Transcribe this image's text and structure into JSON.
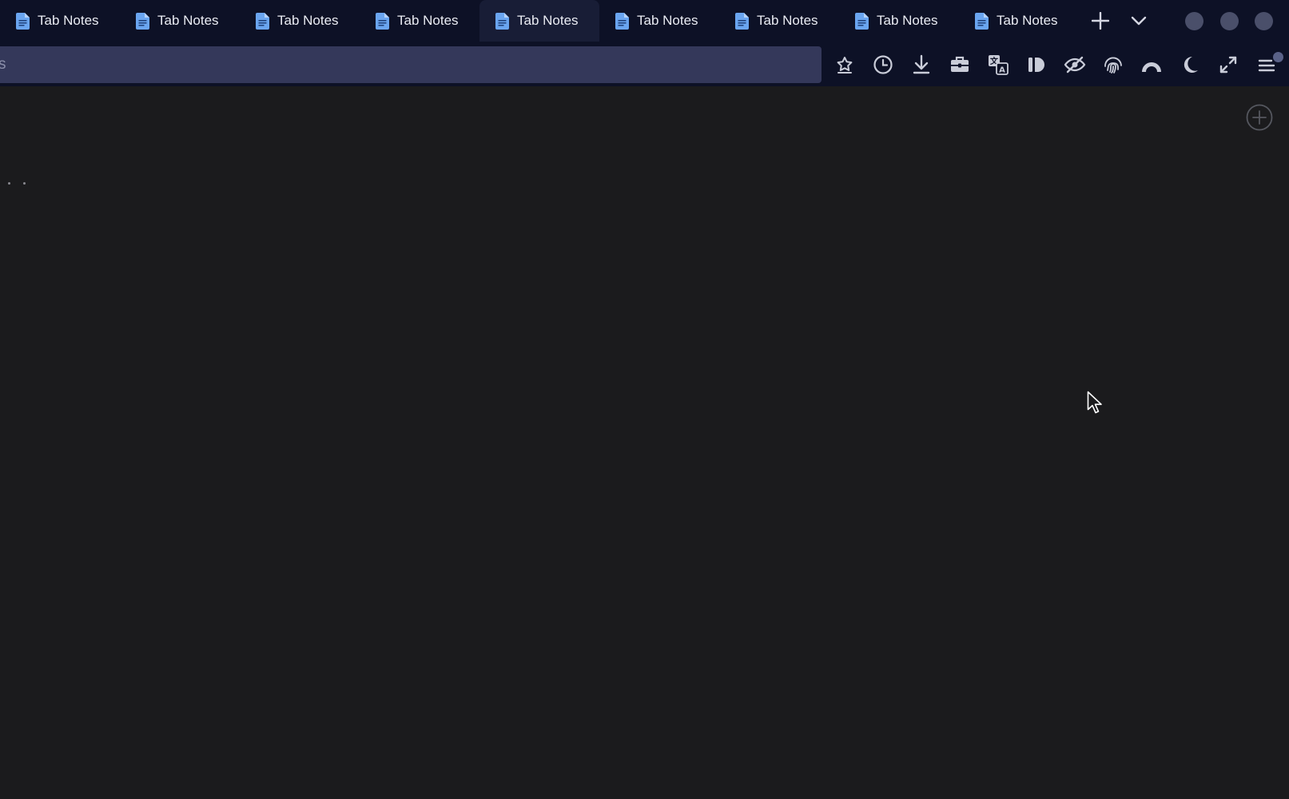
{
  "tabs": [
    {
      "label": "Tab Notes",
      "active": false
    },
    {
      "label": "Tab Notes",
      "active": false
    },
    {
      "label": "Tab Notes",
      "active": false
    },
    {
      "label": "Tab Notes",
      "active": false
    },
    {
      "label": "Tab Notes",
      "active": true
    },
    {
      "label": "Tab Notes",
      "active": false
    },
    {
      "label": "Tab Notes",
      "active": false
    },
    {
      "label": "Tab Notes",
      "active": false
    },
    {
      "label": "Tab Notes",
      "active": false
    }
  ],
  "tabstrip": {
    "new_tab_icon": "plus-icon",
    "tab_list_icon": "chevron-down-icon"
  },
  "urlbar": {
    "value": "s"
  },
  "toolbar": {
    "icons": [
      "bookmark-star-icon",
      "history-clock-icon",
      "download-icon",
      "toolbox-icon",
      "translate-icon",
      "reader-view-icon",
      "hide-eye-icon",
      "fingerprint-icon",
      "rainbow-icon",
      "dark-mode-moon-icon",
      "fullscreen-expand-icon",
      "menu-hamburger-icon"
    ]
  },
  "colors": {
    "tabstrip_bg": "#0d1126",
    "active_tab_bg": "#181d36",
    "urlbar_bg": "#34385a",
    "content_bg": "#1b1b1d",
    "doc_icon": "#6aa5f0",
    "icon_fg": "#c9ccd8"
  }
}
